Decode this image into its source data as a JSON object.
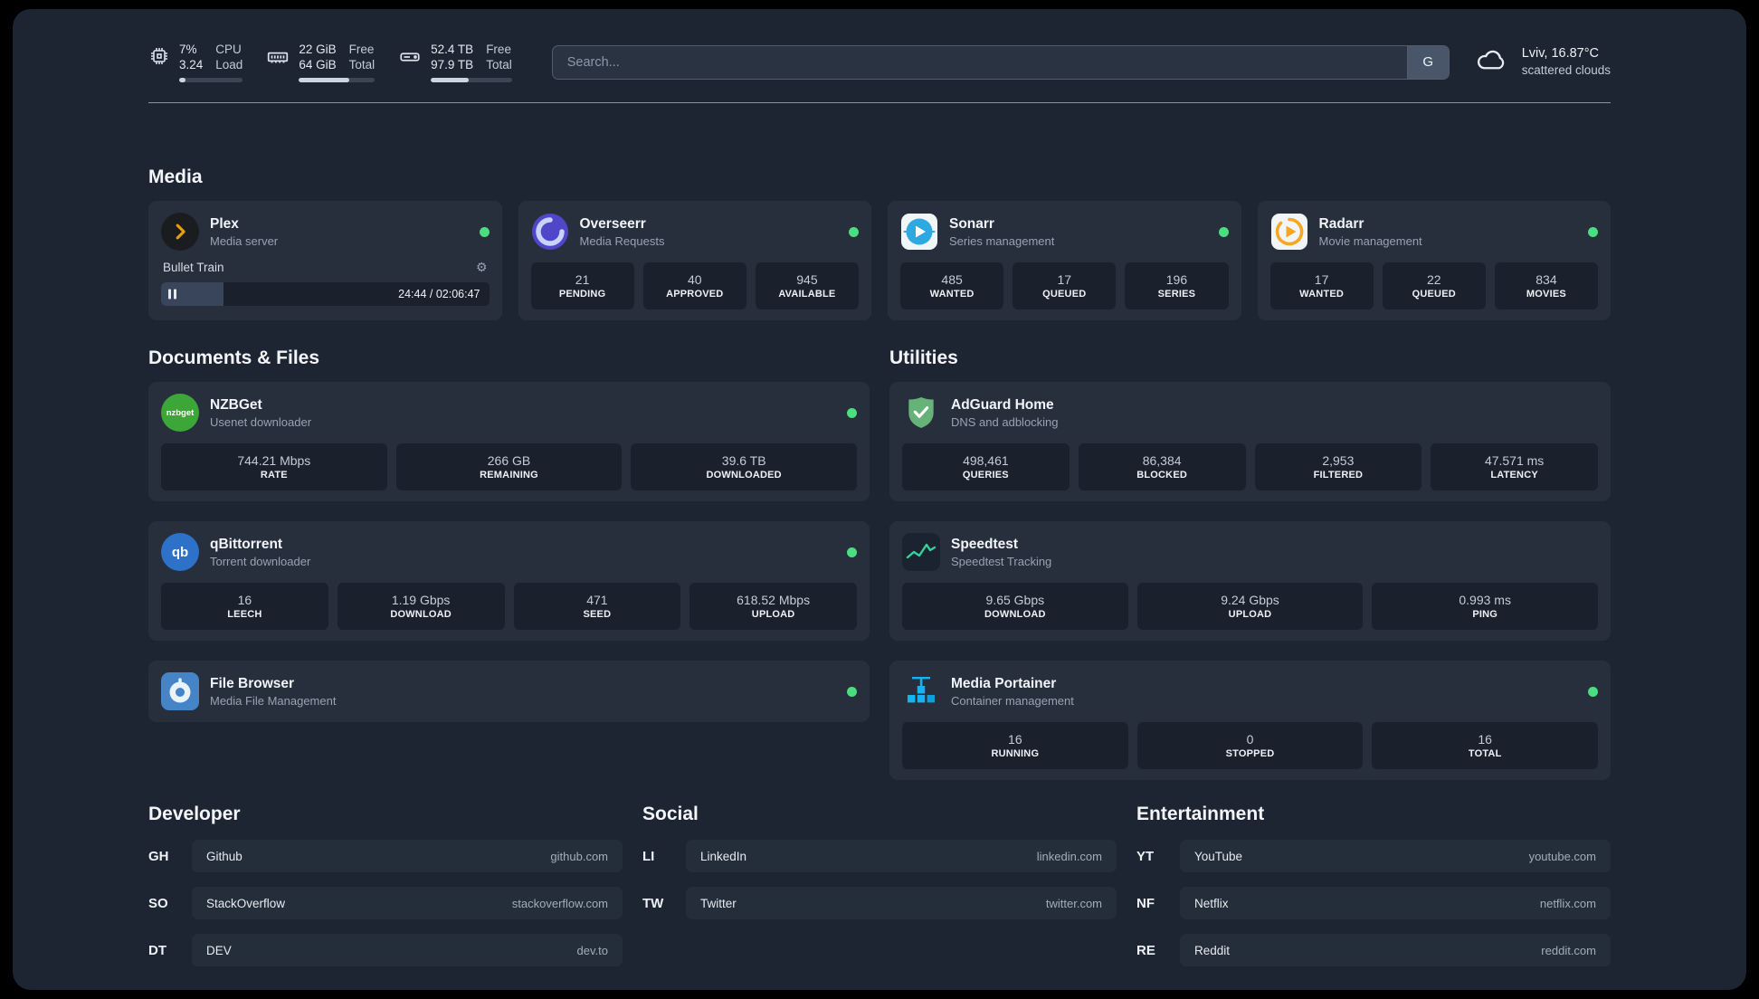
{
  "colors": {
    "status_online": "#4ade80",
    "plex": "#e5a00d",
    "overseerr": "#4f46c8",
    "sonarr": "#2ea8e0",
    "radarr": "#f5a623",
    "nzbget": "#3da639",
    "qbittorrent": "#2d72c8",
    "adguard": "#67b279",
    "speedtest": "#34d399",
    "filebrowser": "#4584c7",
    "portainer": "#16b3f0"
  },
  "topbar": {
    "resources": [
      {
        "icon": "cpu-icon",
        "value_top": "7%",
        "value_bottom": "3.24",
        "label_top": "CPU",
        "label_bottom": "Load",
        "progress_pct": 10
      },
      {
        "icon": "memory-icon",
        "value_top": "22 GiB",
        "value_bottom": "64 GiB",
        "label_top": "Free",
        "label_bottom": "Total",
        "progress_pct": 66
      },
      {
        "icon": "disk-icon",
        "value_top": "52.4 TB",
        "value_bottom": "97.9 TB",
        "label_top": "Free",
        "label_bottom": "Total",
        "progress_pct": 47
      }
    ],
    "search": {
      "placeholder": "Search...",
      "provider_label": "G"
    },
    "weather": {
      "location": "Lviv, 16.87°C",
      "condition": "scattered clouds"
    }
  },
  "media": {
    "title": "Media",
    "plex": {
      "name": "Plex",
      "subtitle": "Media server",
      "player": {
        "title": "Bullet Train",
        "time": "24:44 / 02:06:47",
        "progress_pct": 19
      }
    },
    "overseerr": {
      "name": "Overseerr",
      "subtitle": "Media Requests",
      "stats": [
        {
          "value": "21",
          "label": "PENDING"
        },
        {
          "value": "40",
          "label": "APPROVED"
        },
        {
          "value": "945",
          "label": "AVAILABLE"
        }
      ]
    },
    "sonarr": {
      "name": "Sonarr",
      "subtitle": "Series management",
      "stats": [
        {
          "value": "485",
          "label": "WANTED"
        },
        {
          "value": "17",
          "label": "QUEUED"
        },
        {
          "value": "196",
          "label": "SERIES"
        }
      ]
    },
    "radarr": {
      "name": "Radarr",
      "subtitle": "Movie management",
      "stats": [
        {
          "value": "17",
          "label": "WANTED"
        },
        {
          "value": "22",
          "label": "QUEUED"
        },
        {
          "value": "834",
          "label": "MOVIES"
        }
      ]
    }
  },
  "documents": {
    "title": "Documents & Files",
    "nzbget": {
      "name": "NZBGet",
      "subtitle": "Usenet downloader",
      "icon_text": "nzbget",
      "stats": [
        {
          "value": "744.21 Mbps",
          "label": "RATE"
        },
        {
          "value": "266 GB",
          "label": "REMAINING"
        },
        {
          "value": "39.6 TB",
          "label": "DOWNLOADED"
        }
      ]
    },
    "qbittorrent": {
      "name": "qBittorrent",
      "subtitle": "Torrent downloader",
      "icon_text": "qb",
      "stats": [
        {
          "value": "16",
          "label": "LEECH"
        },
        {
          "value": "1.19 Gbps",
          "label": "DOWNLOAD"
        },
        {
          "value": "471",
          "label": "SEED"
        },
        {
          "value": "618.52 Mbps",
          "label": "UPLOAD"
        }
      ]
    },
    "filebrowser": {
      "name": "File Browser",
      "subtitle": "Media File Management"
    }
  },
  "utilities": {
    "title": "Utilities",
    "adguard": {
      "name": "AdGuard Home",
      "subtitle": "DNS and adblocking",
      "stats": [
        {
          "value": "498,461",
          "label": "QUERIES"
        },
        {
          "value": "86,384",
          "label": "BLOCKED"
        },
        {
          "value": "2,953",
          "label": "FILTERED"
        },
        {
          "value": "47.571 ms",
          "label": "LATENCY"
        }
      ]
    },
    "speedtest": {
      "name": "Speedtest",
      "subtitle": "Speedtest Tracking",
      "stats": [
        {
          "value": "9.65 Gbps",
          "label": "DOWNLOAD"
        },
        {
          "value": "9.24 Gbps",
          "label": "UPLOAD"
        },
        {
          "value": "0.993 ms",
          "label": "PING"
        }
      ]
    },
    "portainer": {
      "name": "Media Portainer",
      "subtitle": "Container management",
      "stats": [
        {
          "value": "16",
          "label": "RUNNING"
        },
        {
          "value": "0",
          "label": "STOPPED"
        },
        {
          "value": "16",
          "label": "TOTAL"
        }
      ]
    }
  },
  "bookmarks": {
    "developer": {
      "title": "Developer",
      "items": [
        {
          "abbr": "GH",
          "name": "Github",
          "url": "github.com"
        },
        {
          "abbr": "SO",
          "name": "StackOverflow",
          "url": "stackoverflow.com"
        },
        {
          "abbr": "DT",
          "name": "DEV",
          "url": "dev.to"
        }
      ]
    },
    "social": {
      "title": "Social",
      "items": [
        {
          "abbr": "LI",
          "name": "LinkedIn",
          "url": "linkedin.com"
        },
        {
          "abbr": "TW",
          "name": "Twitter",
          "url": "twitter.com"
        }
      ]
    },
    "entertainment": {
      "title": "Entertainment",
      "items": [
        {
          "abbr": "YT",
          "name": "YouTube",
          "url": "youtube.com"
        },
        {
          "abbr": "NF",
          "name": "Netflix",
          "url": "netflix.com"
        },
        {
          "abbr": "RE",
          "name": "Reddit",
          "url": "reddit.com"
        }
      ]
    }
  }
}
